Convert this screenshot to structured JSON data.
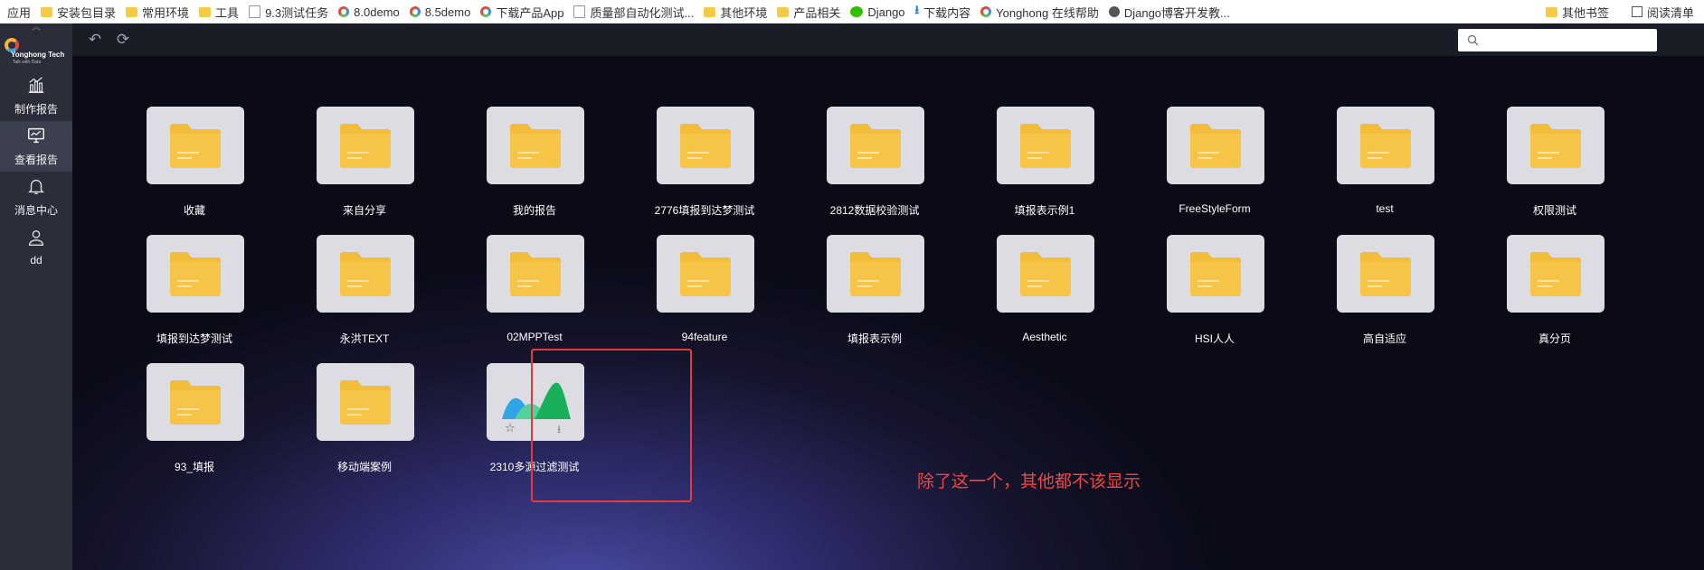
{
  "bookmarks": {
    "items": [
      {
        "label": "应用",
        "icon": "apps-icon"
      },
      {
        "label": "安装包目录",
        "icon": "folder-icon"
      },
      {
        "label": "常用环境",
        "icon": "folder-icon"
      },
      {
        "label": "工具",
        "icon": "folder-icon"
      },
      {
        "label": "9.3测试任务",
        "icon": "page-icon"
      },
      {
        "label": "8.0demo",
        "icon": "yonghong-icon"
      },
      {
        "label": "8.5demo",
        "icon": "yonghong-icon"
      },
      {
        "label": "下载产品App",
        "icon": "yonghong-icon"
      },
      {
        "label": "质量部自动化测试...",
        "icon": "page-icon"
      },
      {
        "label": "其他环境",
        "icon": "folder-icon"
      },
      {
        "label": "产品相关",
        "icon": "folder-icon"
      },
      {
        "label": "Django",
        "icon": "wechat-icon"
      },
      {
        "label": "下载内容",
        "icon": "download-icon"
      },
      {
        "label": "Yonghong 在线帮助",
        "icon": "yonghong-icon"
      },
      {
        "label": "Django博客开发教...",
        "icon": "globe-icon"
      }
    ],
    "other_bookmarks": "其他书签",
    "reading_list": "阅读清单"
  },
  "sidebar": {
    "logo_text": "Yonghong Tech",
    "logo_sub": "Talk with Data",
    "items": [
      {
        "label": "制作报告",
        "icon": "chart-icon",
        "active": false
      },
      {
        "label": "查看报告",
        "icon": "monitor-icon",
        "active": true
      },
      {
        "label": "消息中心",
        "icon": "bell-icon",
        "active": false
      },
      {
        "label": "dd",
        "icon": "user-icon",
        "active": false
      }
    ]
  },
  "toolbar": {
    "back_icon": "undo-icon",
    "refresh_icon": "refresh-icon",
    "search_placeholder": ""
  },
  "colors": {
    "folder": "#f3bd3a",
    "card": "#dcdce2",
    "highlight": "#e03c3c",
    "annotation": "#f04646"
  },
  "tiles": [
    {
      "label": "收藏",
      "type": "folder"
    },
    {
      "label": "来自分享",
      "type": "folder"
    },
    {
      "label": "我的报告",
      "type": "folder"
    },
    {
      "label": "2776填报到达梦测试",
      "type": "folder"
    },
    {
      "label": "2812数据校验测试",
      "type": "folder"
    },
    {
      "label": "填报表示例1",
      "type": "folder"
    },
    {
      "label": "FreeStyleForm",
      "type": "folder"
    },
    {
      "label": "test",
      "type": "folder"
    },
    {
      "label": "权限测试",
      "type": "folder"
    },
    {
      "label": "填报到达梦测试",
      "type": "folder"
    },
    {
      "label": "永洪TEXT",
      "type": "folder"
    },
    {
      "label": "02MPPTest",
      "type": "folder"
    },
    {
      "label": "94feature",
      "type": "folder"
    },
    {
      "label": "填报表示例",
      "type": "folder"
    },
    {
      "label": "Aesthetic",
      "type": "folder"
    },
    {
      "label": "HSI人人",
      "type": "folder"
    },
    {
      "label": "高自适应",
      "type": "folder"
    },
    {
      "label": "真分页",
      "type": "folder"
    },
    {
      "label": "93_填报",
      "type": "folder"
    },
    {
      "label": "移动端案例",
      "type": "folder"
    },
    {
      "label": "2310多源过滤测试",
      "type": "report"
    }
  ],
  "annotation": "除了这一个，其他都不该显示"
}
